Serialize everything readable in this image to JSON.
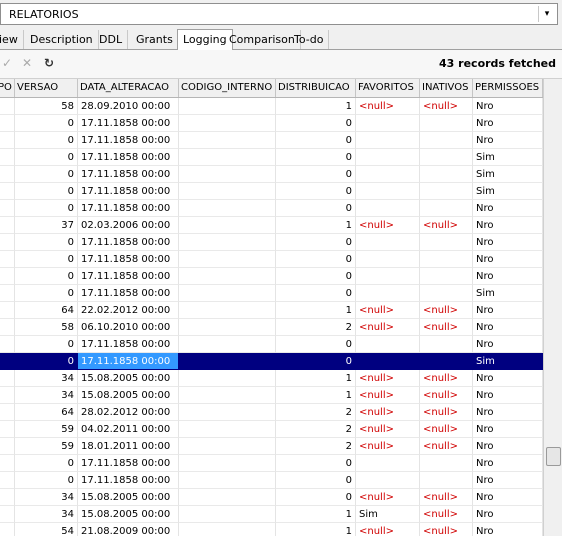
{
  "table_selector": {
    "value": "RELATORIOS",
    "arrow": "▾"
  },
  "tabs": [
    "iew",
    "Description",
    "DDL",
    "Grants",
    "Logging",
    "Comparison",
    "To-do"
  ],
  "toolbar": {
    "status": "43 records fetched"
  },
  "columns": [
    "PO",
    "VERSAO",
    "DATA_ALTERACAO",
    "CODIGO_INTERNO",
    "DISTRIBUICAO",
    "FAVORITOS",
    "INATIVOS",
    "PERMISSOES"
  ],
  "rows": [
    {
      "versao": "58",
      "data": "28.09.2010 00:00",
      "dist": "1",
      "fav": "<null>",
      "inat": "<null>",
      "perm": "Nro"
    },
    {
      "versao": "0",
      "data": "17.11.1858 00:00",
      "dist": "0",
      "fav": "",
      "inat": "",
      "perm": "Nro"
    },
    {
      "versao": "0",
      "data": "17.11.1858 00:00",
      "dist": "0",
      "fav": "",
      "inat": "",
      "perm": "Nro"
    },
    {
      "versao": "0",
      "data": "17.11.1858 00:00",
      "dist": "0",
      "fav": "",
      "inat": "",
      "perm": "Sim"
    },
    {
      "versao": "0",
      "data": "17.11.1858 00:00",
      "dist": "0",
      "fav": "",
      "inat": "",
      "perm": "Sim"
    },
    {
      "versao": "0",
      "data": "17.11.1858 00:00",
      "dist": "0",
      "fav": "",
      "inat": "",
      "perm": "Sim"
    },
    {
      "versao": "0",
      "data": "17.11.1858 00:00",
      "dist": "0",
      "fav": "",
      "inat": "",
      "perm": "Nro"
    },
    {
      "versao": "37",
      "data": "02.03.2006 00:00",
      "dist": "1",
      "fav": "<null>",
      "inat": "<null>",
      "perm": "Nro"
    },
    {
      "versao": "0",
      "data": "17.11.1858 00:00",
      "dist": "0",
      "fav": "",
      "inat": "",
      "perm": "Nro"
    },
    {
      "versao": "0",
      "data": "17.11.1858 00:00",
      "dist": "0",
      "fav": "",
      "inat": "",
      "perm": "Nro"
    },
    {
      "versao": "0",
      "data": "17.11.1858 00:00",
      "dist": "0",
      "fav": "",
      "inat": "",
      "perm": "Nro"
    },
    {
      "versao": "0",
      "data": "17.11.1858 00:00",
      "dist": "0",
      "fav": "",
      "inat": "",
      "perm": "Sim"
    },
    {
      "versao": "64",
      "data": "22.02.2012 00:00",
      "dist": "1",
      "fav": "<null>",
      "inat": "<null>",
      "perm": "Nro"
    },
    {
      "versao": "58",
      "data": "06.10.2010 00:00",
      "dist": "2",
      "fav": "<null>",
      "inat": "<null>",
      "perm": "Nro"
    },
    {
      "versao": "0",
      "data": "17.11.1858 00:00",
      "dist": "0",
      "fav": "",
      "inat": "",
      "perm": "Nro"
    },
    {
      "versao": "0",
      "data": "17.11.1858 00:00",
      "dist": "0",
      "fav": "",
      "inat": "",
      "perm": "Sim",
      "selected": true
    },
    {
      "versao": "34",
      "data": "15.08.2005 00:00",
      "dist": "1",
      "fav": "<null>",
      "inat": "<null>",
      "perm": "Nro"
    },
    {
      "versao": "34",
      "data": "15.08.2005 00:00",
      "dist": "1",
      "fav": "<null>",
      "inat": "<null>",
      "perm": "Nro"
    },
    {
      "versao": "64",
      "data": "28.02.2012 00:00",
      "dist": "2",
      "fav": "<null>",
      "inat": "<null>",
      "perm": "Nro"
    },
    {
      "versao": "59",
      "data": "04.02.2011 00:00",
      "dist": "2",
      "fav": "<null>",
      "inat": "<null>",
      "perm": "Nro"
    },
    {
      "versao": "59",
      "data": "18.01.2011 00:00",
      "dist": "2",
      "fav": "<null>",
      "inat": "<null>",
      "perm": "Nro"
    },
    {
      "versao": "0",
      "data": "17.11.1858 00:00",
      "dist": "0",
      "fav": "",
      "inat": "",
      "perm": "Nro"
    },
    {
      "versao": "0",
      "data": "17.11.1858 00:00",
      "dist": "0",
      "fav": "",
      "inat": "",
      "perm": "Nro"
    },
    {
      "versao": "34",
      "data": "15.08.2005 00:00",
      "dist": "0",
      "fav": "<null>",
      "inat": "<null>",
      "perm": "Nro"
    },
    {
      "versao": "34",
      "data": "15.08.2005 00:00",
      "dist": "1",
      "fav": "Sim",
      "inat": "<null>",
      "perm": "Nro"
    },
    {
      "versao": "54",
      "data": "21.08.2009 00:00",
      "dist": "1",
      "fav": "<null>",
      "inat": "<null>",
      "perm": "Nro"
    }
  ]
}
